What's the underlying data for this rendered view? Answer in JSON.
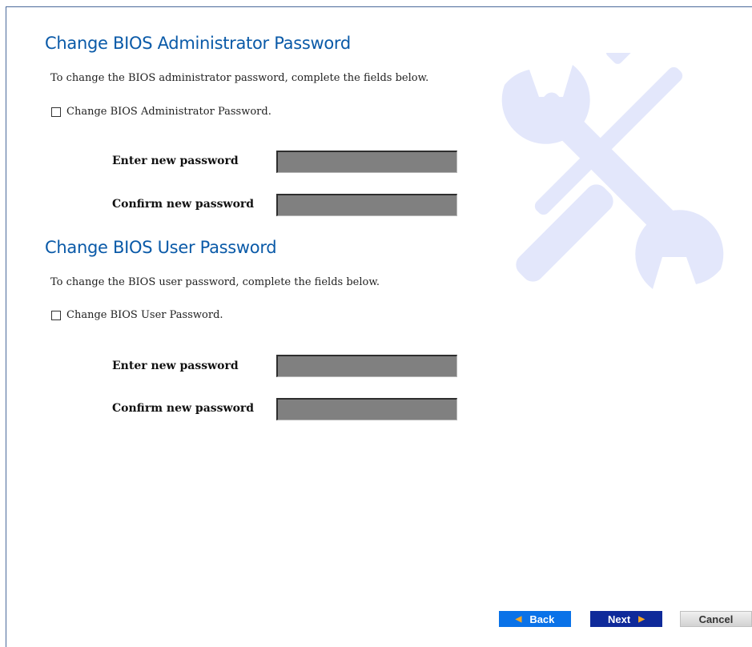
{
  "admin": {
    "title": "Change BIOS Administrator Password",
    "description": "To change the BIOS administrator password, complete the fields below.",
    "checkbox_label": "Change BIOS Administrator Password.",
    "checked": false,
    "new_password_label": "Enter new password",
    "confirm_password_label": "Confirm new password",
    "new_password_value": "",
    "confirm_password_value": ""
  },
  "user": {
    "title": "Change BIOS User Password",
    "description": "To change the BIOS user password, complete the fields below.",
    "checkbox_label": "Change BIOS User Password.",
    "checked": false,
    "new_password_label": "Enter new password",
    "confirm_password_label": "Confirm new password",
    "new_password_value": "",
    "confirm_password_value": ""
  },
  "footer": {
    "back_label": "Back",
    "next_label": "Next",
    "cancel_label": "Cancel",
    "back_icon": "triangle-left-icon",
    "next_icon": "triangle-right-icon"
  },
  "decoration": {
    "watermark_icon": "wrench-screwdriver-icon",
    "watermark_color": "#e3e7fb"
  },
  "colors": {
    "title": "#0a5aa8",
    "input_background": "#808080",
    "back_button": "#0a72e8",
    "next_button": "#0f2a9a",
    "accent_arrow": "#f5a623"
  }
}
